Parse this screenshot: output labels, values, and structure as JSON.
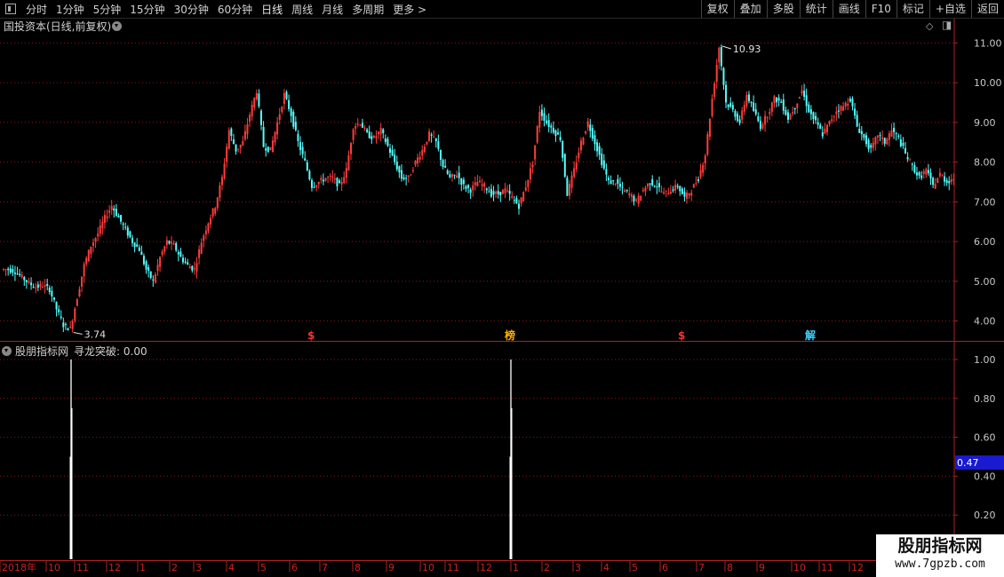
{
  "toolbar": {
    "tabs": [
      "分时",
      "1分钟",
      "5分钟",
      "15分钟",
      "30分钟",
      "60分钟",
      "日线",
      "周线",
      "月线",
      "多周期",
      "更多 >"
    ],
    "active_tab": "日线",
    "right_buttons": [
      "复权",
      "叠加",
      "多股",
      "统计",
      "画线",
      "F10",
      "标记",
      "+自选",
      "返回"
    ]
  },
  "main_chart": {
    "title": "国投资本(日线,前复权)",
    "y_ticks": [
      "11.00",
      "10.00",
      "9.00",
      "8.00",
      "7.00",
      "6.00",
      "5.00",
      "4.00"
    ],
    "high_label": "10.93",
    "low_label": "3.74",
    "markers": [
      {
        "text": "$",
        "color": "#ff3030"
      },
      {
        "text": "榜",
        "color": "#ffb000"
      },
      {
        "text": "$",
        "color": "#ff3030"
      },
      {
        "text": "解",
        "color": "#40d0ff"
      }
    ]
  },
  "indicator": {
    "name": "股朋指标网",
    "formula": "寻龙突破: 0.00",
    "y_ticks": [
      "1.00",
      "0.80",
      "0.60",
      "0.40",
      "0.20"
    ],
    "current_value": "0.47",
    "spikes": [
      1.0,
      1.0
    ]
  },
  "time_axis": {
    "labels": [
      "2018年",
      "10",
      "11",
      "12",
      "1",
      "2",
      "3",
      "4",
      "5",
      "6",
      "7",
      "8",
      "9",
      "10",
      "11",
      "12",
      "1",
      "2",
      "3",
      "4",
      "5",
      "6",
      "7",
      "8",
      "9",
      "10",
      "11",
      "12"
    ]
  },
  "watermark": {
    "line1": "股朋指标网",
    "line2": "www.7gpzb.com"
  },
  "colors": {
    "up": "#ff3c3c",
    "down": "#54ffff",
    "grid": "#8a1a1a",
    "axis": "#b02020"
  },
  "chart_data": {
    "type": "candlestick",
    "title": "国投资本(日线,前复权)",
    "y_range": [
      3.5,
      11.3
    ],
    "close_path_points": [
      5.3,
      5.25,
      5.1,
      4.95,
      4.85,
      4.9,
      4.8,
      4.3,
      3.9,
      3.8,
      4.6,
      5.4,
      5.9,
      6.2,
      6.6,
      6.9,
      6.6,
      6.3,
      6.0,
      5.8,
      5.3,
      5.0,
      5.6,
      6.0,
      5.9,
      5.6,
      5.4,
      5.3,
      6.0,
      6.5,
      6.9,
      7.6,
      8.8,
      8.3,
      8.5,
      9.2,
      9.8,
      8.4,
      8.3,
      9.0,
      9.7,
      9.2,
      8.5,
      8.0,
      7.4,
      7.5,
      7.6,
      7.6,
      7.4,
      7.8,
      8.9,
      9.0,
      8.7,
      8.6,
      8.8,
      8.4,
      8.0,
      7.6,
      7.6,
      8.0,
      8.3,
      8.7,
      8.5,
      7.9,
      7.6,
      7.7,
      7.4,
      7.3,
      7.5,
      7.4,
      7.2,
      7.2,
      7.3,
      7.1,
      6.9,
      7.4,
      8.0,
      9.3,
      9.0,
      8.8,
      8.6,
      7.2,
      7.8,
      8.5,
      9.0,
      8.5,
      8.0,
      7.5,
      7.5,
      7.3,
      7.2,
      7.0,
      7.3,
      7.5,
      7.4,
      7.2,
      7.3,
      7.4,
      7.1,
      7.3,
      7.6,
      8.2,
      9.6,
      10.9,
      9.5,
      9.3,
      9.0,
      9.7,
      9.3,
      8.9,
      9.2,
      9.6,
      9.5,
      9.1,
      9.4,
      9.8,
      9.3,
      9.0,
      8.7,
      9.0,
      9.3,
      9.4,
      9.6,
      8.9,
      8.6,
      8.3,
      8.7,
      8.5,
      8.8,
      8.6,
      8.2,
      7.9,
      7.6,
      7.8,
      7.4,
      7.7,
      7.5,
      7.6
    ]
  }
}
